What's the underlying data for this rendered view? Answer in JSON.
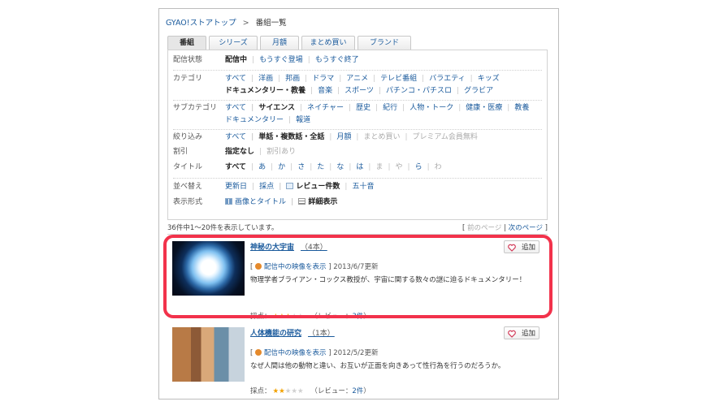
{
  "breadcrumb": {
    "root": "GYAO!ストアトップ",
    "separator": ">",
    "current": "番組一覧"
  },
  "tabs": [
    "番組",
    "シリーズ",
    "月額",
    "まとめ買い",
    "ブランド"
  ],
  "filters": {
    "status": {
      "label": "配信状態",
      "values": [
        "配信中",
        "もうすぐ登場",
        "もうすぐ終了"
      ]
    },
    "category": {
      "label": "カテゴリ",
      "values": [
        "すべて",
        "洋画",
        "邦画",
        "ドラマ",
        "アニメ",
        "テレビ番組",
        "バラエティ",
        "キッズ"
      ],
      "values2": [
        "ドキュメンタリー・教養",
        "音楽",
        "スポーツ",
        "パチンコ・パチスロ",
        "グラビア"
      ]
    },
    "subcategory": {
      "label": "サブカテゴリ",
      "values": [
        "すべて",
        "サイエンス",
        "ネイチャー",
        "歴史",
        "紀行",
        "人物・トーク",
        "健康・医療",
        "教養"
      ],
      "values2": [
        "ドキュメンタリー",
        "報道"
      ]
    },
    "narrow": {
      "label": "絞り込み",
      "values": [
        "すべて",
        "単話・複数話・全話",
        "月額",
        "まとめ買い",
        "プレミアム会員無料"
      ]
    },
    "discount": {
      "label": "割引",
      "values": [
        "指定なし",
        "割引あり"
      ]
    },
    "title": {
      "label": "タイトル",
      "values": [
        "すべて",
        "あ",
        "か",
        "さ",
        "た",
        "な",
        "は",
        "ま",
        "や",
        "ら",
        "わ"
      ]
    },
    "sort": {
      "label": "並べ替え",
      "values": [
        "更新日",
        "採点",
        "レビュー件数",
        "五十音"
      ]
    },
    "display": {
      "label": "表示形式",
      "values": [
        "画像とタイトル",
        "詳細表示"
      ]
    }
  },
  "results": {
    "count_text": "36件中1〜20件を表示しています。",
    "prev": "前のページ",
    "next": "次のページ"
  },
  "items": [
    {
      "title": "神秘の大宇宙",
      "episodes": "（4本）",
      "add_label": "追加",
      "now_streaming": "配信中の映像を表示",
      "updated": "2013/6/7更新",
      "description": "物理学者ブライアン・コックス教授が、宇宙に関する数々の謎に迫るドキュメンタリー！",
      "rating_label": "採点：",
      "stars": 3,
      "review_prefix": "（レビュー：",
      "review_count": "3件",
      "review_suffix": "）"
    },
    {
      "title": "人体機能の研究",
      "episodes": "（1本）",
      "add_label": "追加",
      "now_streaming": "配信中の映像を表示",
      "updated": "2012/5/2更新",
      "description": "なぜ人間は他の動物と違い、お互いが正面を向きあって性行為を行うのだろうか。",
      "rating_label": "採点：",
      "stars": 2,
      "review_prefix": "（レビュー：",
      "review_count": "2件",
      "review_suffix": "）"
    }
  ]
}
